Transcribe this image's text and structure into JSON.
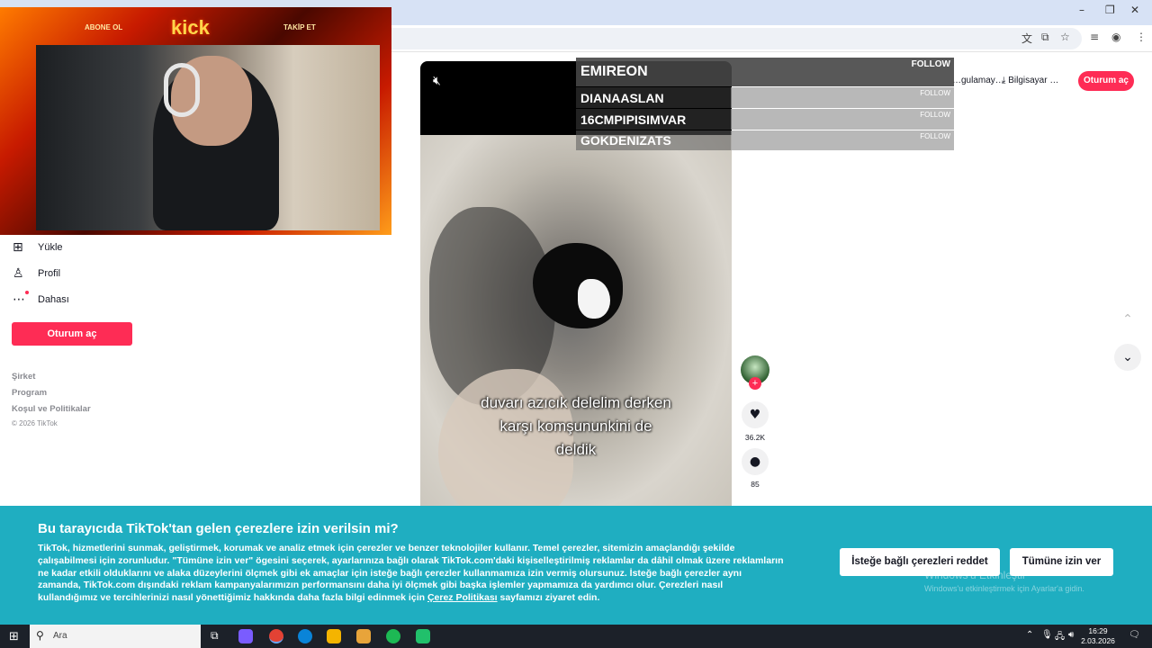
{
  "browser": {
    "window_controls": [
      "–",
      "❐",
      "✕"
    ],
    "toolbar_icons": [
      "translate-icon",
      "install-icon",
      "star-icon",
      "media-icon",
      "profile-icon",
      "menu-icon"
    ]
  },
  "tiktok": {
    "top_links": {
      "app": "…gulamay…",
      "desktop": "Bilgisayar …",
      "login": "Oturum aç"
    },
    "sidebar": {
      "items": [
        {
          "label": "Yükle",
          "icon": "upload-icon"
        },
        {
          "label": "Profil",
          "icon": "profile-icon"
        },
        {
          "label": "Dahası",
          "icon": "more-icon"
        }
      ],
      "login": "Oturum aç",
      "footer": [
        "Şirket",
        "Program",
        "Koşul ve Politikalar"
      ],
      "copyright": "© 2026 TikTok"
    },
    "video": {
      "caption_lines": [
        "duvarı azıcık delelim derken",
        "karşı komşununkini de",
        "deldik"
      ],
      "likes": "36.2K",
      "comments": "85"
    }
  },
  "stream_overlay": {
    "follow_label": "FOLLOW",
    "followers": [
      "EMIREON",
      "DIANAASLAN",
      "16CMPIPISIMVAR",
      "GOKDENIZATS"
    ],
    "webcam": {
      "logo": "kick",
      "left_tag": "ABONE OL",
      "right_tag": "TAKİP ET"
    }
  },
  "cookie_banner": {
    "title": "Bu tarayıcıda TikTok'tan gelen çerezlere izin verilsin mi?",
    "body": "TikTok, hizmetlerini sunmak, geliştirmek, korumak ve analiz etmek için çerezler ve benzer teknolojiler kullanır. Temel çerezler, sitemizin amaçlandığı şekilde çalışabilmesi için zorunludur. \"Tümüne izin ver\" ögesini seçerek, ayarlarınıza bağlı olarak TikTok.com'daki kişiselleştirilmiş reklamlar da dâhil olmak üzere reklamların ne kadar etkili olduklarını ve alaka düzeylerini ölçmek gibi ek amaçlar için isteğe bağlı çerezler kullanmamıza izin vermiş olursunuz. İsteğe bağlı çerezler aynı zamanda, TikTok.com dışındaki reklam kampanyalarımızın performansını daha iyi ölçmek gibi başka işlemler yapmamıza da yardımcı olur. Çerezleri nasıl kullandığımız ve tercihlerinizi nasıl yönettiğimiz hakkında daha fazla bilgi edinmek için ",
    "link": "Çerez Politikası",
    "body_end": " sayfamızı ziyaret edin.",
    "reject_button": "İsteğe bağlı çerezleri reddet",
    "accept_button": "Tümüne izin ver",
    "watermark_line1": "Windows'u Etkinleştir",
    "watermark_line2": "Windows'u etkinleştirmek için Ayarlar'a gidin."
  },
  "taskbar": {
    "search_placeholder": "Ara",
    "time": "16:29",
    "date": "2.03.2026",
    "app_colors": [
      "#7a5cff",
      "#e34234",
      "#0a84d8",
      "#f4b400",
      "#e8a43a",
      "#1db954",
      "#21c06b"
    ]
  }
}
